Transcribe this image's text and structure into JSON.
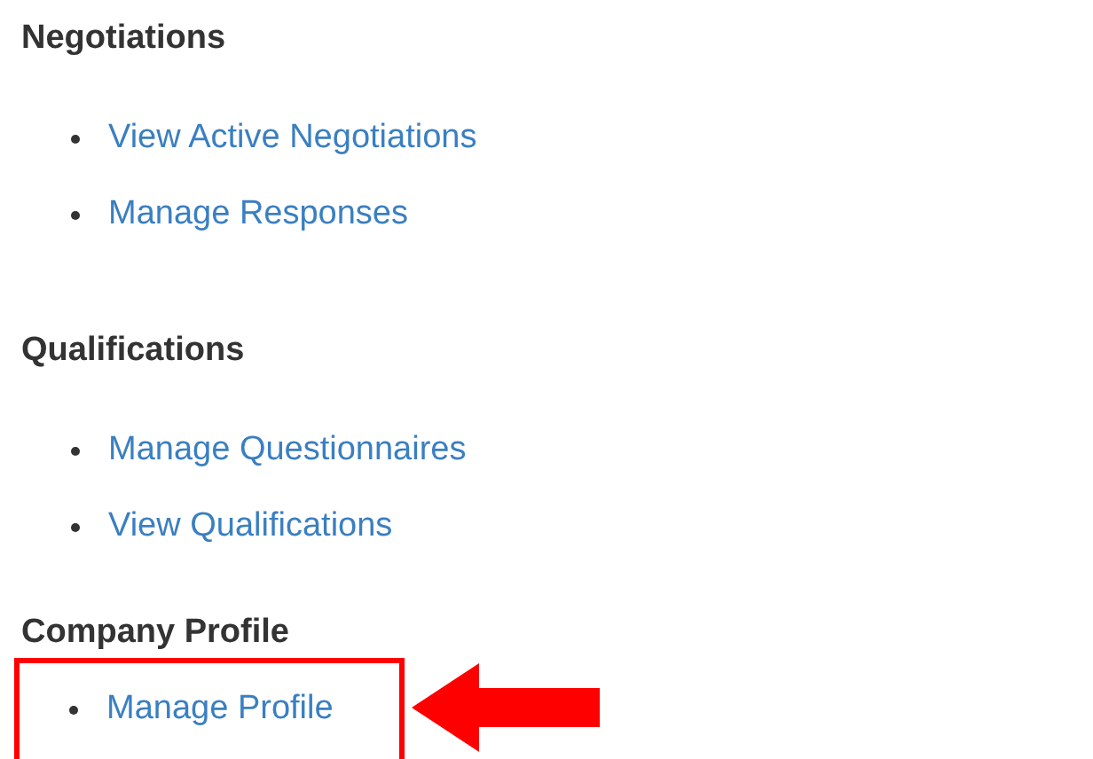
{
  "sections": [
    {
      "heading": "Negotiations",
      "links": [
        {
          "label": "View Active Negotiations",
          "highlighted": false
        },
        {
          "label": "Manage Responses",
          "highlighted": false
        }
      ]
    },
    {
      "heading": "Qualifications",
      "links": [
        {
          "label": "Manage Questionnaires",
          "highlighted": false
        },
        {
          "label": "View Qualifications",
          "highlighted": false
        }
      ]
    },
    {
      "heading": "Company Profile",
      "links": [
        {
          "label": "Manage Profile",
          "highlighted": true
        }
      ]
    }
  ]
}
